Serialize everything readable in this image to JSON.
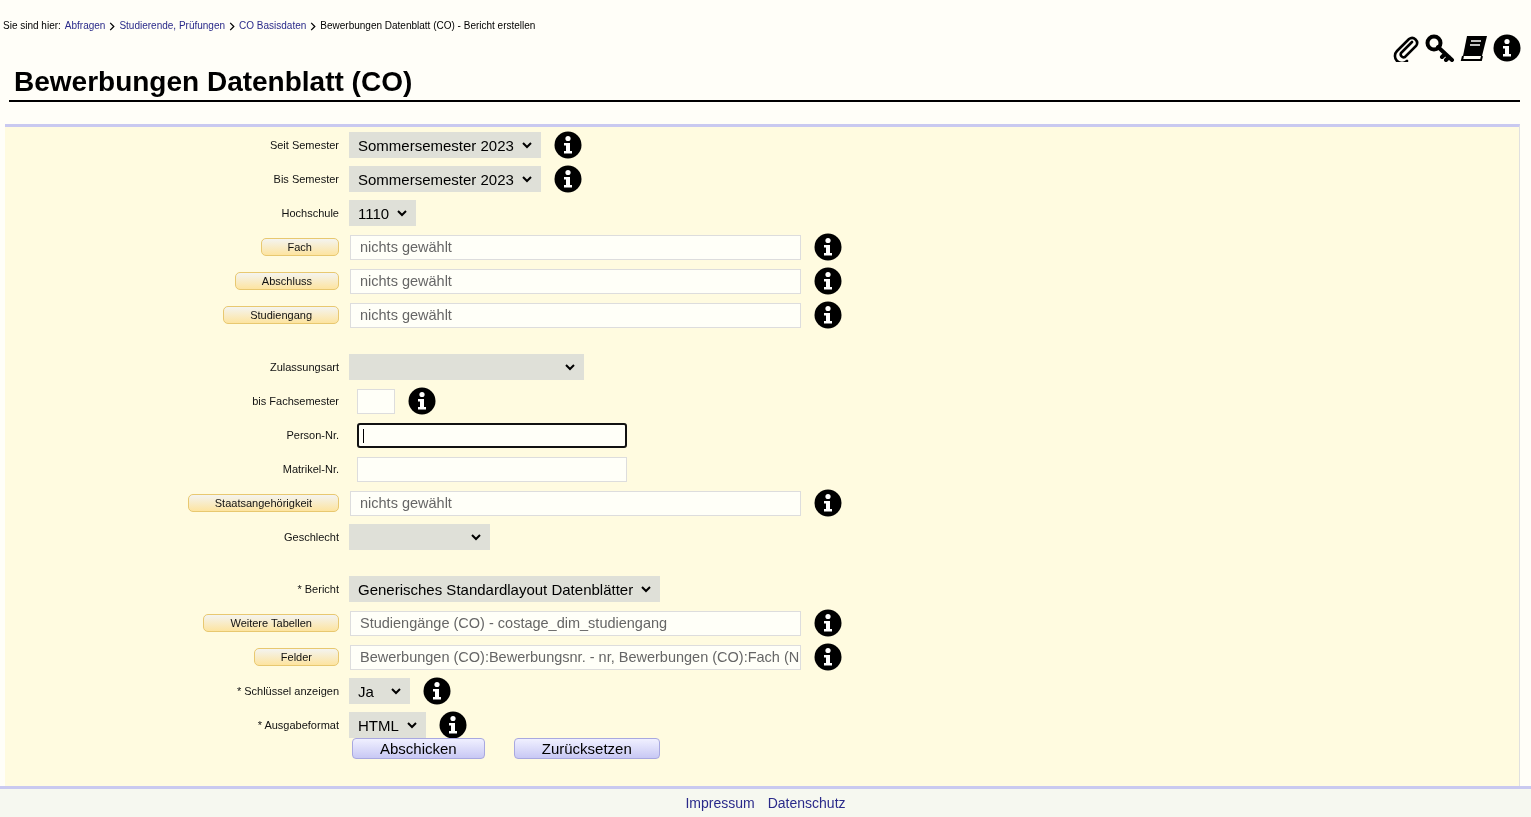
{
  "breadcrumb": {
    "prefix": "Sie sind hier:",
    "links": [
      "Abfragen",
      "Studierende, Prüfungen",
      "CO Basisdaten"
    ],
    "current": "Bewerbungen Datenblatt (CO) - Bericht erstellen"
  },
  "title": "Bewerbungen Datenblatt (CO)",
  "form": {
    "rows": [
      {
        "kind": "select",
        "label": "Seit Semester",
        "value": "Sommersemester 2023",
        "info": true
      },
      {
        "kind": "select",
        "label": "Bis Semester",
        "value": "Sommersemester 2023",
        "info": true
      },
      {
        "kind": "select",
        "label": "Hochschule",
        "value": "1110",
        "info": false
      },
      {
        "kind": "picker",
        "label": "Fach",
        "value": "nichts gewählt",
        "info": true
      },
      {
        "kind": "picker",
        "label": "Abschluss",
        "value": "nichts gewählt",
        "info": true
      },
      {
        "kind": "picker",
        "label": "Studiengang",
        "value": "nichts gewählt",
        "info": true
      },
      {
        "kind": "gap"
      },
      {
        "kind": "select",
        "label": "Zulassungsart",
        "info": false
      },
      {
        "kind": "small",
        "label": "bis Fachsemester",
        "info": true,
        "focused": false
      },
      {
        "kind": "text",
        "label": "Person-Nr.",
        "info": false,
        "focused": true
      },
      {
        "kind": "text",
        "label": "Matrikel-Nr.",
        "info": false,
        "focused": false
      },
      {
        "kind": "picker",
        "label": "Staatsangehörigkeit",
        "value": "nichts gewählt",
        "info": true
      },
      {
        "kind": "select",
        "label": "Geschlecht",
        "info": false
      },
      {
        "kind": "gap"
      },
      {
        "kind": "select",
        "label": "* Bericht",
        "value": "Generisches Standardlayout Datenblätter",
        "info": false
      },
      {
        "kind": "picker",
        "label": "Weitere Tabellen",
        "value": "Studiengänge (CO) - costage_dim_studiengang",
        "info": true
      },
      {
        "kind": "picker",
        "label": "Felder",
        "value": "Bewerbungen (CO):Bewerbungsnr. - nr, Bewerbungen (CO):Fach (N",
        "info": true
      },
      {
        "kind": "select",
        "label": "* Schlüssel anzeigen",
        "value": "Ja",
        "info": true
      },
      {
        "kind": "select",
        "label": "* Ausgabeformat",
        "value": "HTML",
        "info": true
      }
    ],
    "buttons": [
      "Abschicken",
      "Zurücksetzen"
    ]
  },
  "footer": [
    "Impressum",
    "Datenschutz"
  ]
}
